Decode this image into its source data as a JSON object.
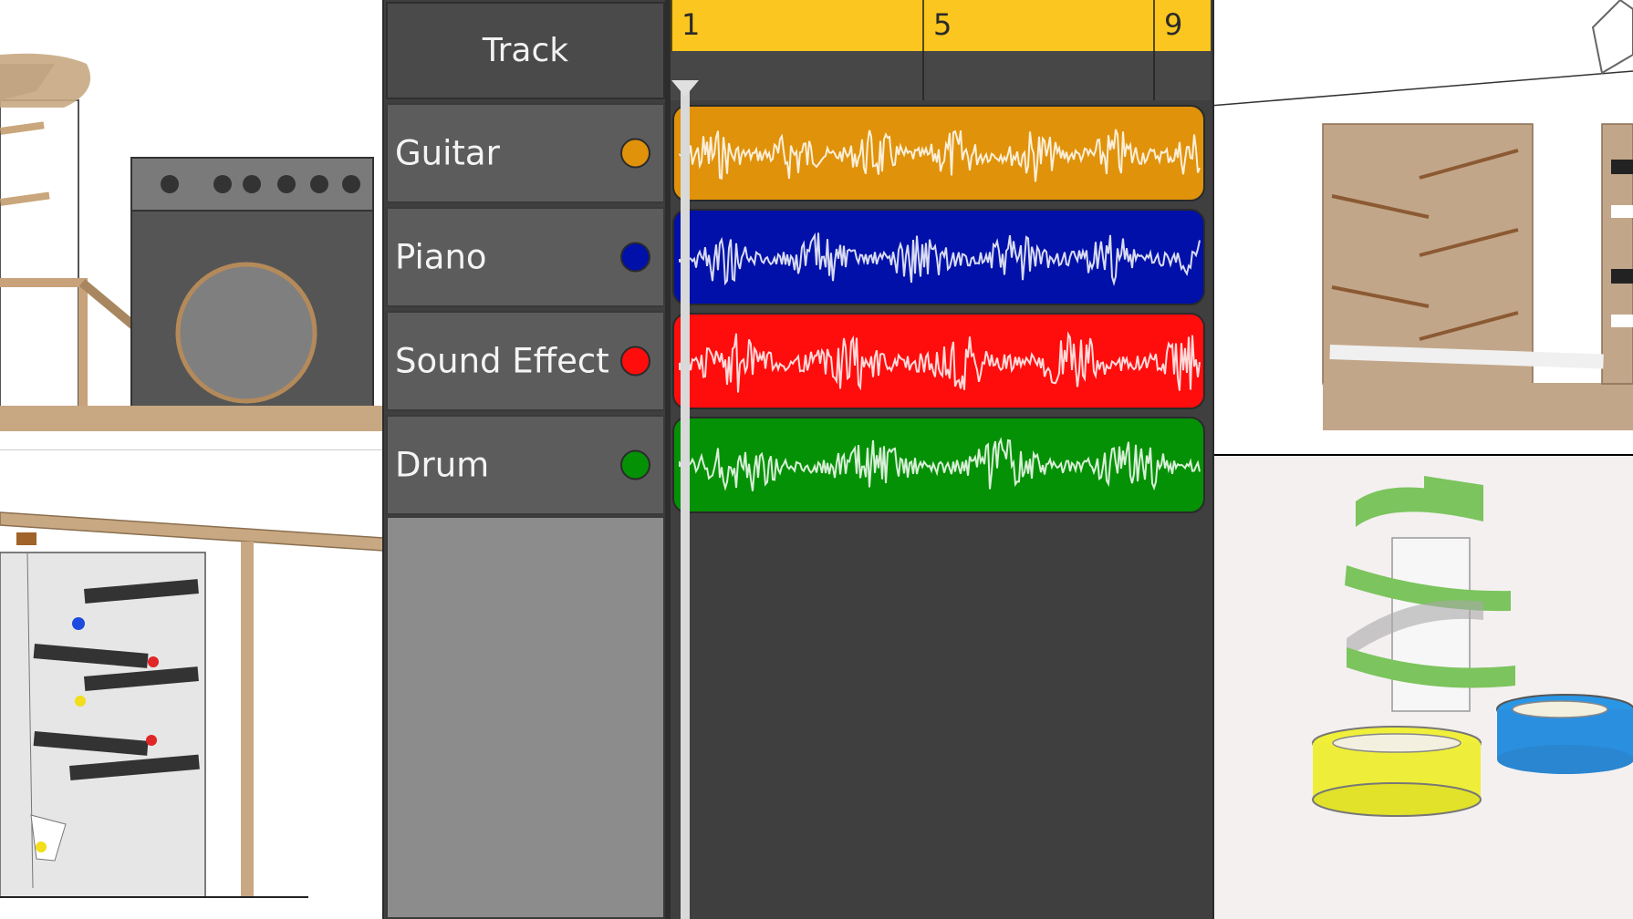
{
  "header": {
    "track_label": "Track"
  },
  "ruler": {
    "bars": [
      "1",
      "5",
      "9"
    ]
  },
  "tracks": [
    {
      "name": "Guitar",
      "color": "#e0920a"
    },
    {
      "name": "Piano",
      "color": "#0010a8"
    },
    {
      "name": "Sound Effect",
      "color": "#ff0c0c"
    },
    {
      "name": "Drum",
      "color": "#059105"
    }
  ],
  "colors": {
    "ruler": "#fbc620",
    "panel_bg": "#3f3f3f",
    "track_bg": "#5c5c5c",
    "empty_track_bg": "#8c8c8c",
    "playhead": "#d9d9d9"
  },
  "playback": {
    "position_bar": 1
  }
}
